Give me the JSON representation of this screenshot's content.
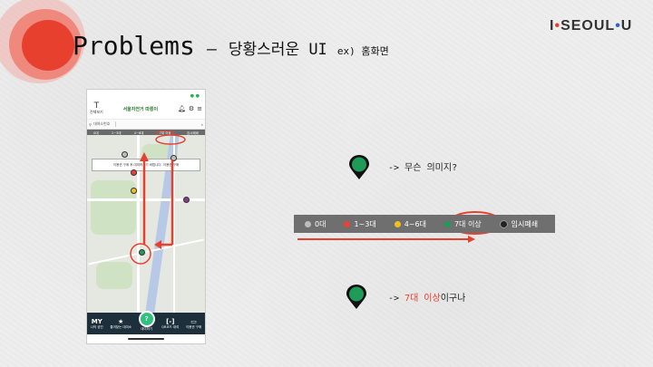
{
  "slide": {
    "title": "Problems",
    "dash": "–",
    "subtitle": "당황스러운 UI",
    "subtitle_small": "ex) 홈화면"
  },
  "brand": {
    "part1": "I",
    "part2": "SEOUL",
    "part3": "U"
  },
  "phone": {
    "header_menu_label": "전체보기",
    "logo_text": "서울자전거 따릉이",
    "header_icons": [
      "알림",
      "QR",
      "메뉴"
    ],
    "search_text": "대여소번호",
    "filter_labels": [
      "0대",
      "1~3대",
      "4~6대",
      "7대 이상",
      "임시폐쇄"
    ],
    "notice_text": "이용권 구매 후 대여하시기 바랍니다. 이용권 구매",
    "nav_items": [
      {
        "icon": "MY",
        "label": "나의 공간"
      },
      {
        "icon": "★",
        "label": "즐겨찾는 대여소"
      },
      {
        "icon": "?",
        "label": "대여하기"
      },
      {
        "icon": "[-]",
        "label": "QR코드 대여"
      },
      {
        "icon": "▭",
        "label": "이용권 구매"
      }
    ]
  },
  "legend": {
    "items": [
      {
        "label": "0대",
        "color": "#bdbdbd"
      },
      {
        "label": "1~3대",
        "color": "#e8403a"
      },
      {
        "label": "4~6대",
        "color": "#f0c020"
      },
      {
        "label": "7대 이상",
        "color": "#1e9b57"
      },
      {
        "label": "임시폐쇄",
        "color": "#222222"
      }
    ]
  },
  "notes": {
    "question": "-> 무슨 의미지?",
    "answer_prefix": "-> ",
    "answer_highlight": "7대 이상",
    "answer_suffix": "이구나"
  },
  "colors": {
    "accent_red": "#e8402f",
    "pin_green": "#1e9b57"
  }
}
